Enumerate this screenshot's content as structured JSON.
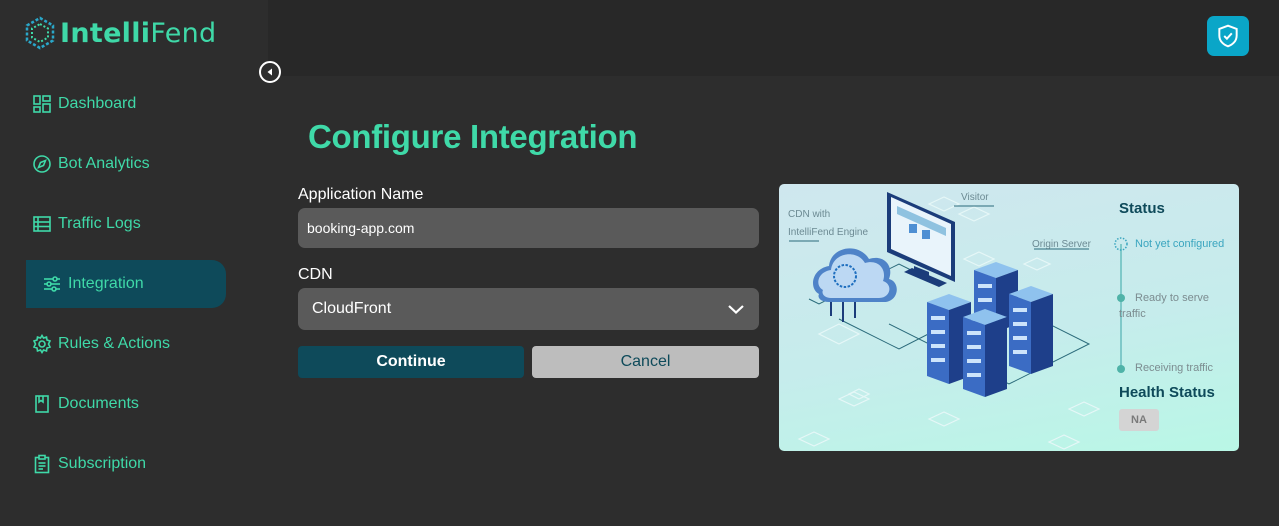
{
  "brand": {
    "name_bold": "Intelli",
    "name_light": "Fend"
  },
  "sidebar": {
    "items": [
      {
        "label": "Dashboard",
        "icon": "dashboard-icon"
      },
      {
        "label": "Bot Analytics",
        "icon": "compass-icon"
      },
      {
        "label": "Traffic Logs",
        "icon": "table-icon"
      },
      {
        "label": "Integration",
        "icon": "sliders-icon",
        "active": true
      },
      {
        "label": "Rules & Actions",
        "icon": "gear-icon"
      },
      {
        "label": "Documents",
        "icon": "book-icon"
      },
      {
        "label": "Subscription",
        "icon": "clipboard-icon"
      }
    ]
  },
  "header": {
    "action_icon": "shield-check-icon"
  },
  "main": {
    "title": "Configure Integration",
    "app_name_label": "Application Name",
    "app_name_value": "booking-app.com",
    "cdn_label": "CDN",
    "cdn_value": "CloudFront",
    "continue_label": "Continue",
    "cancel_label": "Cancel"
  },
  "illustration": {
    "cdn_label_1": "CDN with",
    "cdn_label_2": "IntelliFend Engine",
    "visitor_label": "Visitor",
    "origin_label": "Origin Server",
    "status_title": "Status",
    "steps": [
      "Not yet configured",
      "Ready to serve",
      "traffic",
      "Receiving traffic"
    ],
    "health_title": "Health Status",
    "health_value": "NA"
  },
  "colors": {
    "accent": "#3fd9a8",
    "teal_dark": "#0e4a5a",
    "shield": "#0aa6c8"
  }
}
